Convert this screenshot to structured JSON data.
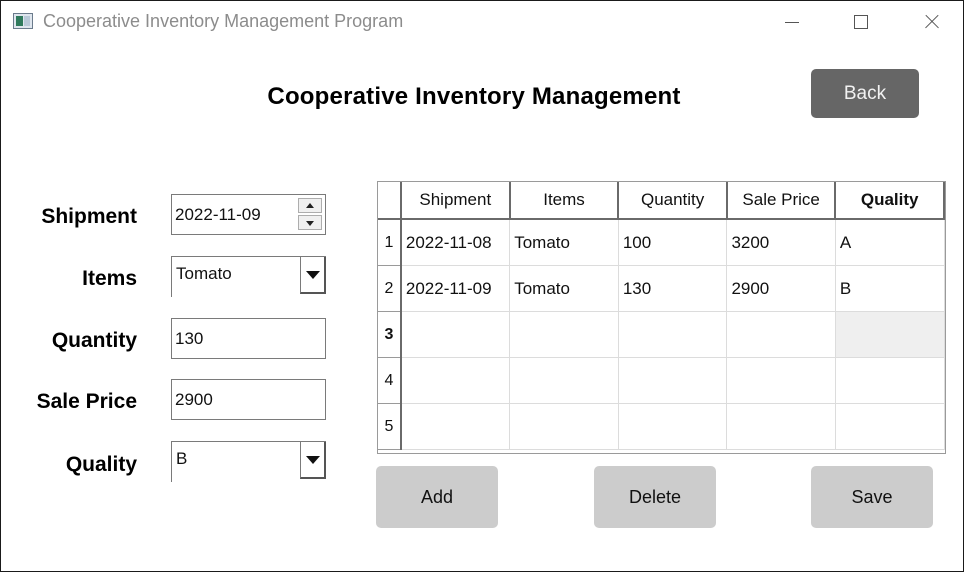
{
  "window": {
    "title": "Cooperative Inventory Management Program"
  },
  "header": {
    "title": "Cooperative Inventory Management",
    "back_label": "Back"
  },
  "form": {
    "shipment": {
      "label": "Shipment",
      "value": "2022-11-09"
    },
    "items": {
      "label": "Items",
      "value": "Tomato"
    },
    "quantity": {
      "label": "Quantity",
      "value": "130"
    },
    "sale_price": {
      "label": "Sale Price",
      "value": "2900"
    },
    "quality": {
      "label": "Quality",
      "value": "B"
    }
  },
  "table": {
    "columns": [
      "Shipment",
      "Items",
      "Quantity",
      "Sale Price",
      "Quality"
    ],
    "row_headers": [
      "1",
      "2",
      "3",
      "4",
      "5"
    ],
    "rows": [
      [
        "2022-11-08",
        "Tomato",
        "100",
        "3200",
        "A"
      ],
      [
        "2022-11-09",
        "Tomato",
        "130",
        "2900",
        "B"
      ],
      [
        "",
        "",
        "",
        "",
        ""
      ],
      [
        "",
        "",
        "",
        "",
        ""
      ],
      [
        "",
        "",
        "",
        "",
        ""
      ]
    ]
  },
  "actions": {
    "add_label": "Add",
    "delete_label": "Delete",
    "save_label": "Save"
  },
  "icons": {
    "app": "app-window-icon",
    "minimize": "minimize-icon",
    "maximize": "maximize-icon",
    "close": "close-icon"
  }
}
